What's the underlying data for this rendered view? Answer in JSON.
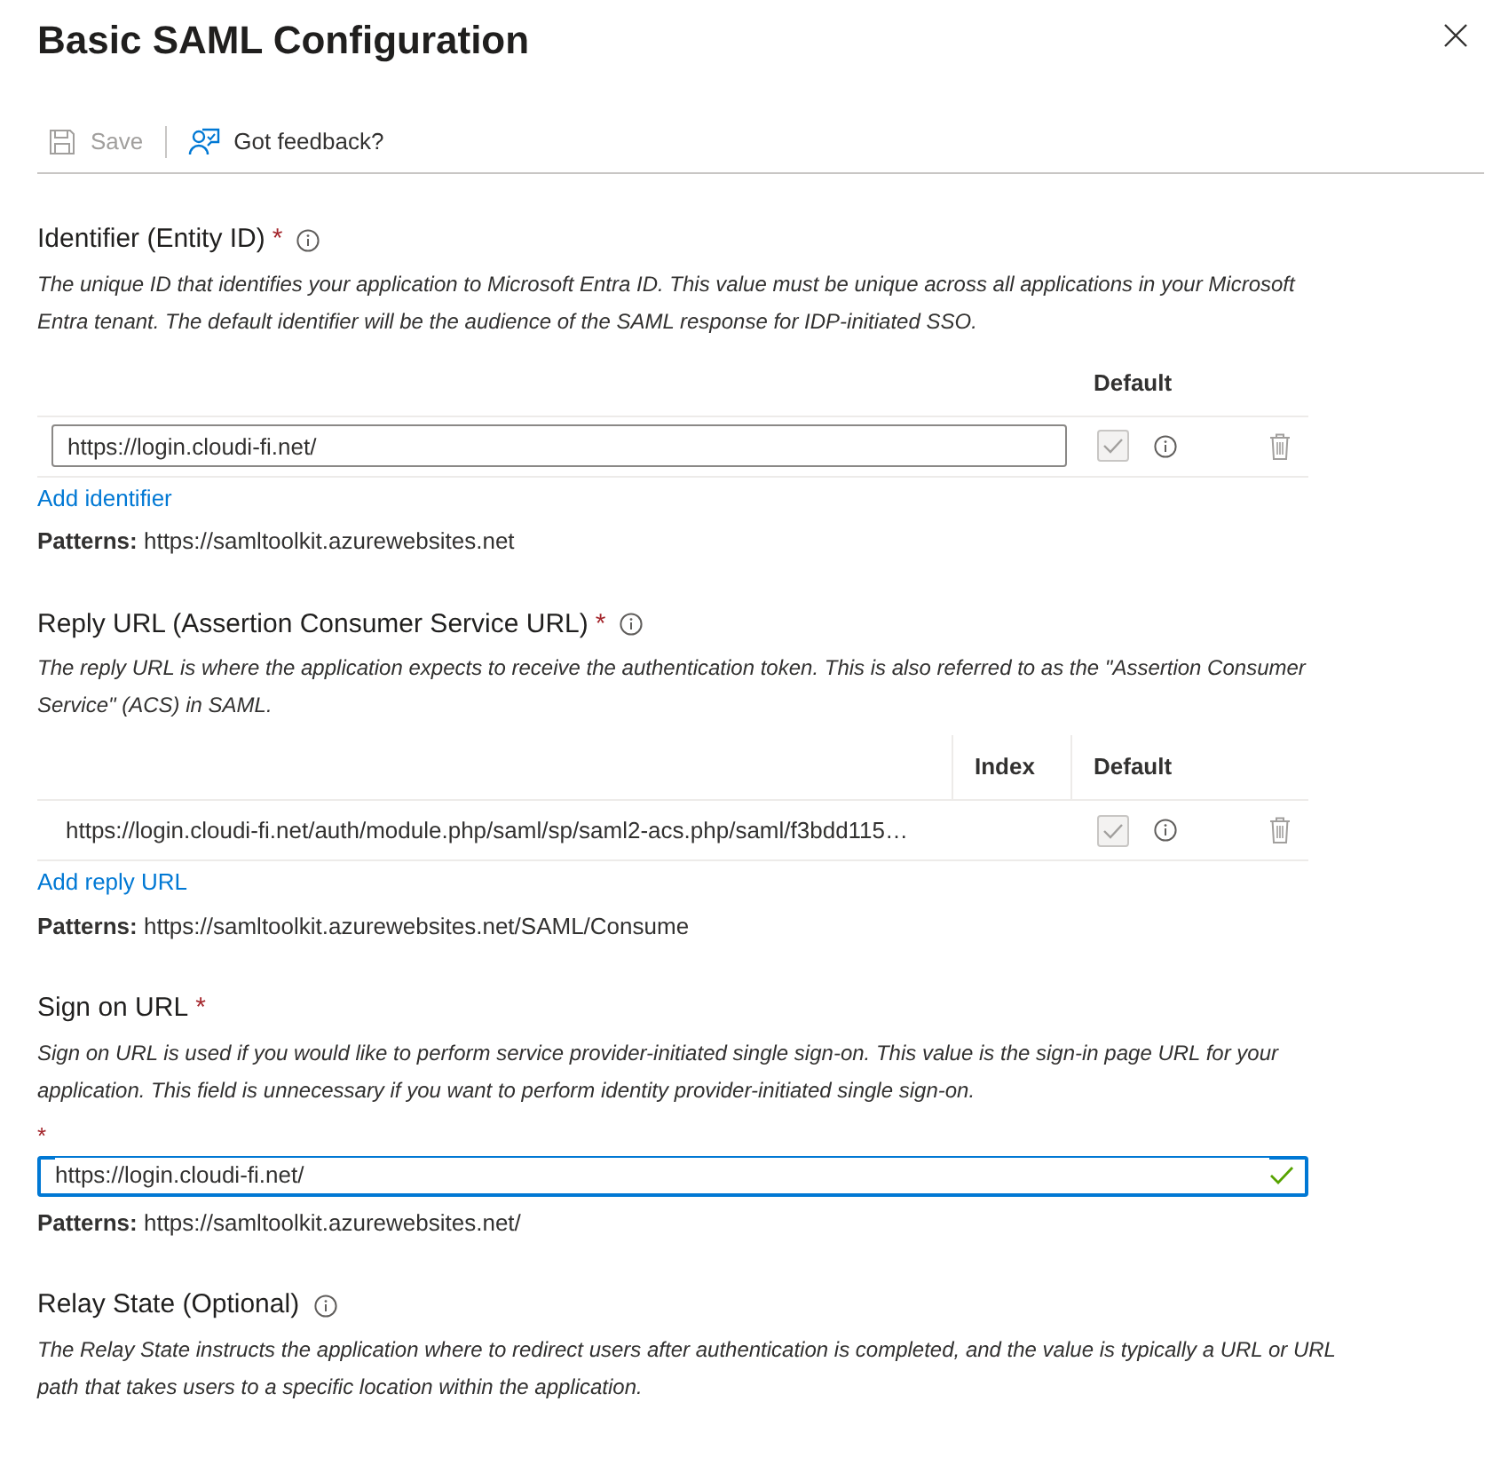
{
  "panel": {
    "title": "Basic SAML Configuration"
  },
  "toolbar": [
    {
      "kind": "save",
      "label": "Save",
      "disabled": true
    },
    {
      "kind": "feedback",
      "label": "Got feedback?",
      "disabled": false
    }
  ],
  "sections": [
    {
      "kind": "table",
      "title": "Identifier (Entity ID)",
      "required_mark": "*",
      "info": true,
      "description": "The unique ID that identifies your application to Microsoft Entra ID. This value must be unique across all applications in your Microsoft Entra tenant. The default identifier will be the audience of the SAML response for IDP-initiated SSO.",
      "columns": [
        "Default"
      ],
      "rows": [
        {
          "kind": "input",
          "value": "https://login.cloudi-fi.net/",
          "default_checked": true
        }
      ],
      "add_link": "Add identifier",
      "patterns": "**Patterns:** https://samltoolkit.azurewebsites.net"
    },
    {
      "kind": "table",
      "title": "Reply URL (Assertion Consumer Service URL)",
      "required_mark": "*",
      "info": true,
      "description": "The reply URL is where the application expects to receive the authentication token. This is also referred to as the \"Assertion Consumer Service\" (ACS) in SAML.",
      "columns": [
        "Index",
        "Default"
      ],
      "rows": [
        {
          "kind": "text",
          "value": "https://login.cloudi-fi.net/auth/module.php/saml/sp/saml2-acs.php/saml/f3bdd115…",
          "default_checked": true
        }
      ],
      "add_link": "Add reply URL",
      "patterns": "**Patterns:** https://samltoolkit.azurewebsites.net/SAML/Consume"
    },
    {
      "kind": "field",
      "title": "Sign on URL",
      "required_mark": "*",
      "description": "Sign on URL is used if you would like to perform service provider-initiated single sign-on. This value is the sign-in page URL for your application. This field is unnecessary if you want to perform identity provider-initiated single sign-on.",
      "field_mark": "*",
      "value": "https://login.cloudi-fi.net/",
      "valid": true,
      "focused": true,
      "patterns": "**Patterns:** https://samltoolkit.azurewebsites.net/"
    },
    {
      "kind": "text",
      "title": "Relay State (Optional)",
      "info": true,
      "description": "The Relay State instructs the application where to redirect users after authentication is completed, and the value is typically a URL or URL path that takes users to a specific location within the application."
    }
  ]
}
